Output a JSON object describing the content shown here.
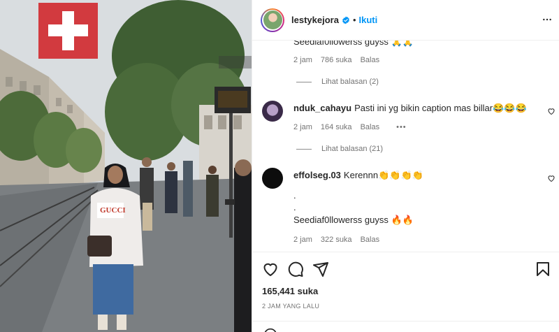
{
  "header": {
    "username": "lestykejora",
    "follow_label": "Ikuti",
    "separator": "•"
  },
  "comments": {
    "cut_text": "Seediaf0llowerss guyss 🙏🙏",
    "items": [
      {
        "time": "2 jam",
        "likes": "786 suka",
        "reply": "Balas",
        "view_replies": "Lihat balasan (2)"
      },
      {
        "username": "nduk_cahayu",
        "text": "Pasti ini yg bikin caption mas billar😂😂😂",
        "time": "2 jam",
        "likes": "164 suka",
        "reply": "Balas",
        "more": "•••",
        "view_replies": "Lihat balasan (21)"
      },
      {
        "username": "effolseg.03",
        "text": "Kerennn👏👏👏👏",
        "line2": ".",
        "line3": ".",
        "line4": "Seediaf0llowerss guyss 🔥🔥",
        "time": "2 jam",
        "likes": "322 suka",
        "reply": "Balas"
      }
    ]
  },
  "actions": {
    "likes": "165,441 suka",
    "time": "2 JAM YANG LALU"
  },
  "colors": {
    "accent": "#0095f6",
    "muted": "#737373",
    "text": "#262626"
  },
  "icons": [
    "verified-icon",
    "more-icon",
    "heart-icon",
    "comment-icon",
    "share-icon",
    "bookmark-icon"
  ]
}
